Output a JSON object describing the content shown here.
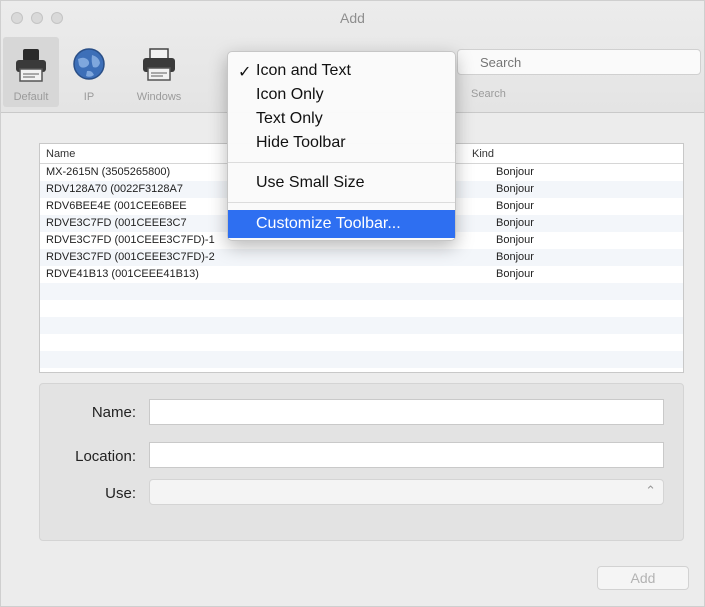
{
  "window": {
    "title": "Add"
  },
  "toolbar": {
    "items": [
      {
        "label": "Default",
        "icon": "printer-default-icon",
        "selected": true
      },
      {
        "label": "IP",
        "icon": "globe-icon",
        "selected": false
      },
      {
        "label": "Windows",
        "icon": "printer-icon",
        "selected": false
      }
    ],
    "search": {
      "placeholder": "Search",
      "label": "Search"
    }
  },
  "context_menu": {
    "items": [
      {
        "label": "Icon and Text",
        "checked": "✓"
      },
      {
        "label": "Icon Only"
      },
      {
        "label": "Text Only"
      },
      {
        "label": "Hide Toolbar"
      },
      {
        "label": "Use Small Size"
      },
      {
        "label": "Customize Toolbar...",
        "highlighted": true
      }
    ]
  },
  "list": {
    "columns": {
      "name": "Name",
      "kind": "Kind",
      "sort_indicator": "^"
    },
    "rows": [
      {
        "name": "MX-2615N (3505265800)",
        "kind": "Bonjour"
      },
      {
        "name": "RDV128A70 (0022F3128A7",
        "kind": "Bonjour"
      },
      {
        "name": "RDV6BEE4E (001CEE6BEE",
        "kind": "Bonjour"
      },
      {
        "name": "RDVE3C7FD (001CEEE3C7",
        "kind": "Bonjour"
      },
      {
        "name": "RDVE3C7FD (001CEEE3C7FD)-1",
        "kind": "Bonjour"
      },
      {
        "name": "RDVE3C7FD (001CEEE3C7FD)-2",
        "kind": "Bonjour"
      },
      {
        "name": "RDVE41B13 (001CEEE41B13)",
        "kind": "Bonjour"
      }
    ]
  },
  "form": {
    "name_label": "Name:",
    "name_value": "",
    "location_label": "Location:",
    "location_value": "",
    "use_label": "Use:",
    "use_value": ""
  },
  "buttons": {
    "add_label": "Add"
  },
  "colors": {
    "menu_highlight": "#2e6ff1",
    "window_bg": "#ececec"
  }
}
